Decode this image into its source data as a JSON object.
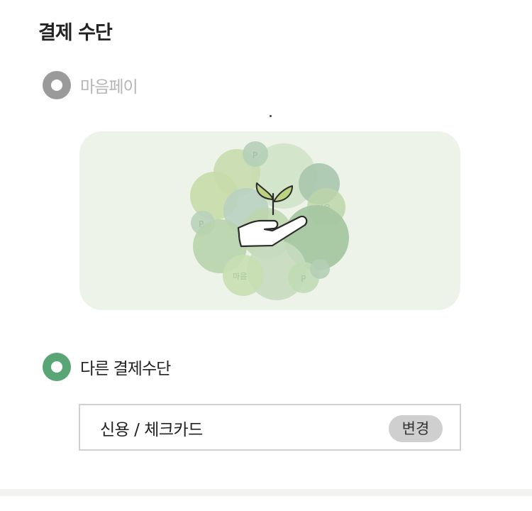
{
  "section": {
    "title": "결제 수단"
  },
  "payment_options": [
    {
      "label": "마음페이",
      "selected": false,
      "disabled": true
    },
    {
      "label": "다른 결제수단",
      "selected": true,
      "disabled": false
    }
  ],
  "banner": {
    "icon": "hand-holding-sprout-icon",
    "coin_labels": [
      "P",
      "P",
      "P",
      "마음",
      "마음"
    ]
  },
  "card": {
    "label": "신용 / 체크카드",
    "change_label": "변경"
  },
  "colors": {
    "accent": "#5aa575",
    "radio_off": "#9a9a9a",
    "banner_bg": "#edf3e9",
    "change_button_bg": "#cfcfcf"
  }
}
